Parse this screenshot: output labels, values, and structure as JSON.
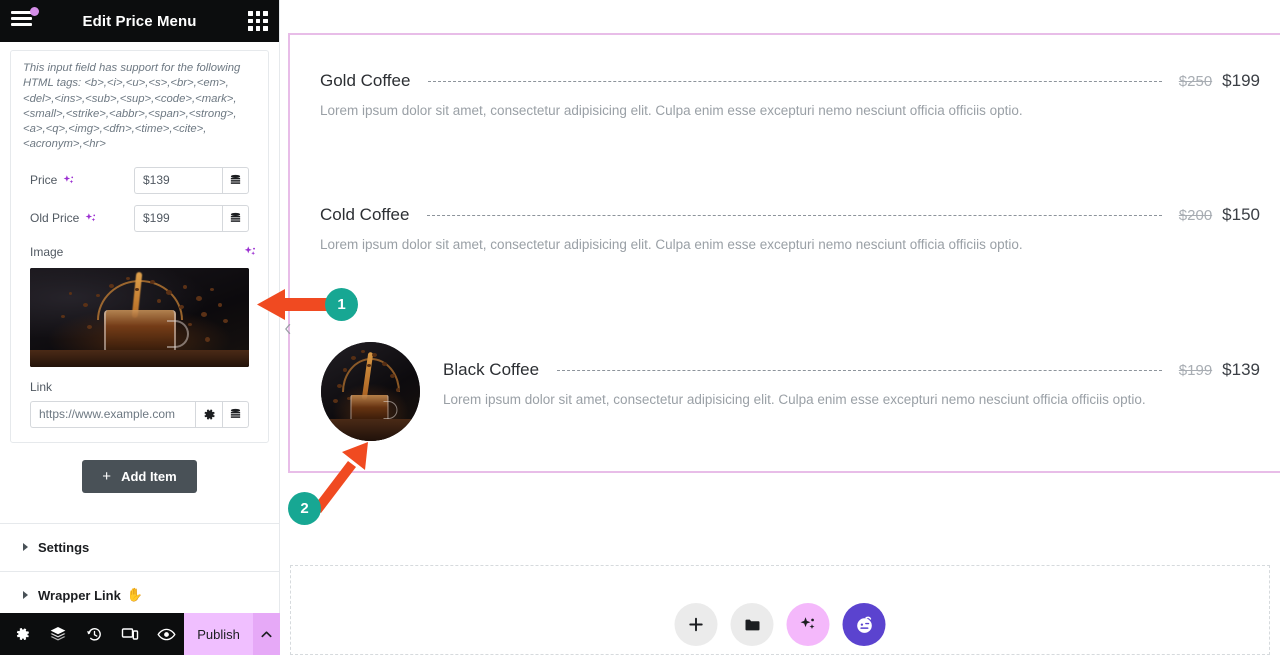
{
  "panel": {
    "title": "Edit Price Menu",
    "menu_icon": "hamburger-icon",
    "apps_icon": "grid-apps-icon",
    "html_note": "This input field has support for the following HTML tags: <b>,<i>,<u>,<s>,<br>,<em>,<del>,<ins>,<sub>,<sup>,<code>,<mark>,<small>,<strike>,<abbr>,<span>,<strong>,<a>,<q>,<img>,<dfn>,<time>,<cite>,<acronym>,<hr>",
    "fields": {
      "price": {
        "label": "Price",
        "value": "$139",
        "dynamic_icon": "database-stack-icon",
        "ai_icon": "sparkle-icon"
      },
      "old_price": {
        "label": "Old Price",
        "value": "$199",
        "dynamic_icon": "database-stack-icon",
        "ai_icon": "sparkle-icon"
      },
      "image": {
        "label": "Image",
        "ai_icon": "sparkle-icon"
      },
      "link": {
        "label": "Link",
        "value": "https://www.example.com",
        "settings_icon": "gear-icon",
        "dynamic_icon": "database-stack-icon"
      }
    },
    "add_item": {
      "label": "Add Item",
      "plus": "+"
    },
    "sections": [
      {
        "label": "Settings",
        "caret": "caret-right-icon"
      },
      {
        "label": "Wrapper Link",
        "caret": "caret-right-icon",
        "emoji": "✋"
      }
    ],
    "footer": {
      "tools": [
        {
          "name": "settings-gear-icon"
        },
        {
          "name": "layers-navigator-icon"
        },
        {
          "name": "history-revisions-icon"
        },
        {
          "name": "responsive-mode-icon"
        },
        {
          "name": "preview-eye-icon"
        }
      ],
      "publish_label": "Publish",
      "publish_caret": "chevron-up-icon"
    }
  },
  "canvas": {
    "collapse_handle": "chevron-left-icon",
    "menu_items": [
      {
        "title": "Gold Coffee",
        "desc": "Lorem ipsum dolor sit amet, consectetur adipisicing elit. Culpa enim esse excepturi nemo nesciunt officia officiis optio.",
        "old_price": "$250",
        "price": "$199",
        "has_image": false
      },
      {
        "title": "Cold Coffee",
        "desc": "Lorem ipsum dolor sit amet, consectetur adipisicing elit. Culpa enim esse excepturi nemo nesciunt officia officiis optio.",
        "old_price": "$200",
        "price": "$150",
        "has_image": false
      },
      {
        "title": "Black Coffee",
        "desc": "Lorem ipsum dolor sit amet, consectetur adipisicing elit. Culpa enim esse excepturi nemo nesciunt officia officiis optio.",
        "old_price": "$199",
        "price": "$139",
        "has_image": true
      }
    ],
    "fabs": [
      {
        "name": "add-element-button",
        "glyph": "+",
        "style": "grey"
      },
      {
        "name": "folder-templates-button",
        "glyph": "folder-icon",
        "style": "grey"
      },
      {
        "name": "ai-sparkle-button",
        "glyph": "sparkle-icon",
        "style": "pink"
      },
      {
        "name": "assistant-face-button",
        "glyph": "face-icon",
        "style": "purple"
      }
    ]
  },
  "annotations": [
    {
      "number": "1",
      "arrow": "arrow-left",
      "target": "image-thumbnail-field"
    },
    {
      "number": "2",
      "arrow": "arrow-up-right",
      "target": "black-coffee-thumbnail"
    }
  ],
  "colors": {
    "accent_pink": "#e8bde8",
    "publish_bg": "#f0bfff",
    "annotation_orange": "#f04a21",
    "annotation_badge": "#17a793",
    "header_dark": "#0c0d0e"
  }
}
